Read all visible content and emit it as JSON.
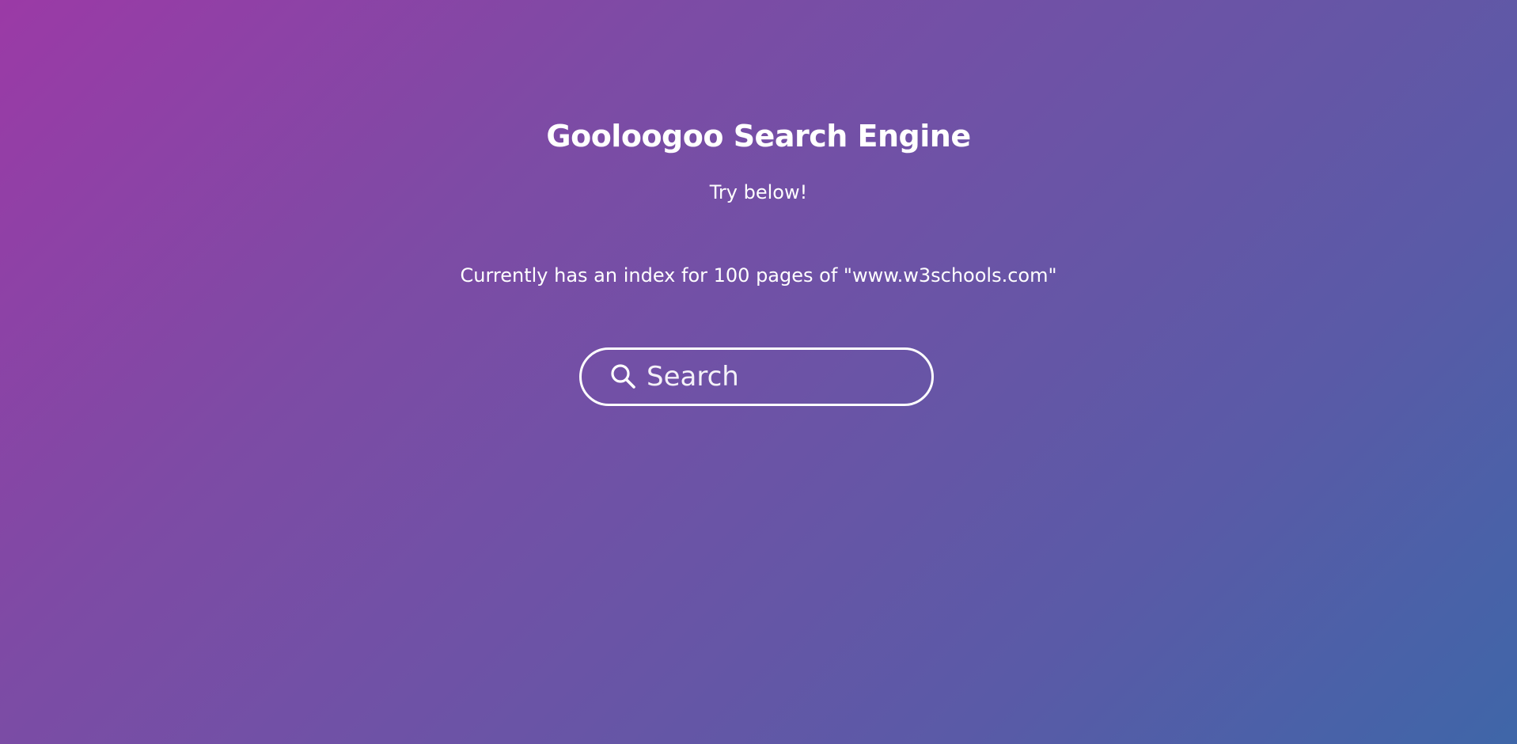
{
  "header": {
    "title": "Gooloogoo Search Engine",
    "subtitle": "Try below!",
    "index_info": "Currently has an index for 100 pages of \"www.w3schools.com\""
  },
  "search": {
    "placeholder": "Search",
    "value": "",
    "icon": "search-icon"
  },
  "colors": {
    "gradient_start": "#9b3aa6",
    "gradient_end": "#3f66a8",
    "text": "#ffffff"
  }
}
